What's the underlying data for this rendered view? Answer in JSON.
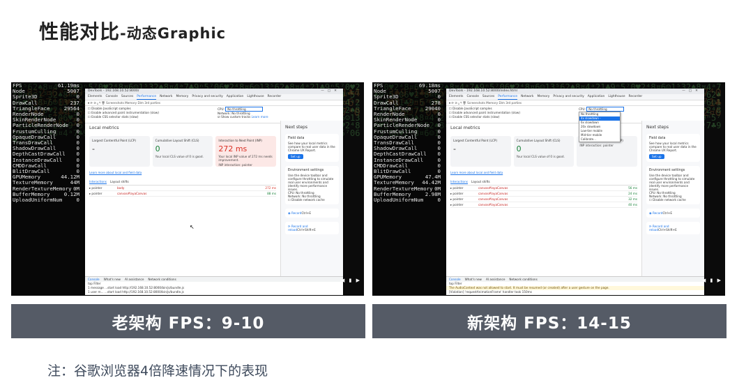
{
  "slide": {
    "title_main": "性能对比",
    "title_sub": "-动态Graphic",
    "note": "注：谷歌浏览器4倍降速情况下的表现"
  },
  "left": {
    "caption": "老架构  FPS：9-10",
    "stats": [
      {
        "k": "FPS",
        "v": "61.19ms"
      },
      {
        "k": "Node",
        "v": "5007"
      },
      {
        "k": "Sprite3D",
        "v": "0"
      },
      {
        "k": "DrawCall",
        "v": "237"
      },
      {
        "k": "TriangleFace",
        "v": "29564"
      },
      {
        "k": "RenderNode",
        "v": "0"
      },
      {
        "k": "SkinRenderNode",
        "v": "0"
      },
      {
        "k": "ParticleRenderNode",
        "v": "0"
      },
      {
        "k": "FrustumCulling",
        "v": "0"
      },
      {
        "k": "OpaqueDrawCall",
        "v": "0"
      },
      {
        "k": "TransDrawCall",
        "v": "0"
      },
      {
        "k": "ShadowDrawCall",
        "v": "0"
      },
      {
        "k": "DepthCastDrawCall",
        "v": "0"
      },
      {
        "k": "InstanceDrawCall",
        "v": "0"
      },
      {
        "k": "CMDDrawCall",
        "v": "0"
      },
      {
        "k": "BlitDrawCall",
        "v": "0"
      },
      {
        "k": "GPUMemory",
        "v": "44.12M"
      },
      {
        "k": "TextureMemory",
        "v": "44M"
      },
      {
        "k": "RenderTextureMemory",
        "v": "0M"
      },
      {
        "k": "BufferMemory",
        "v": "0.12M"
      },
      {
        "k": "UploadUniformNum",
        "v": "0"
      }
    ],
    "devtools": {
      "window_title": "DevTools - 192.168.10.52:8000/",
      "interactions": [
        {
          "a": "pointer",
          "b": "body",
          "c": "272 ms",
          "cls": "warn"
        },
        {
          "a": "pointer",
          "b": "canvas#layaCanvas",
          "c": "88 ms",
          "cls": "ok"
        }
      ],
      "inp_value": "272 ms",
      "cls_value": "0"
    }
  },
  "right": {
    "caption": "新架构 FPS：14-15",
    "stats": [
      {
        "k": "FPS",
        "v": "69.18ms"
      },
      {
        "k": "Node",
        "v": "5007"
      },
      {
        "k": "Sprite3D",
        "v": "0"
      },
      {
        "k": "DrawCall",
        "v": "278"
      },
      {
        "k": "TriangleFace",
        "v": "29040"
      },
      {
        "k": "RenderNode",
        "v": "0"
      },
      {
        "k": "SkinRenderNode",
        "v": "0"
      },
      {
        "k": "ParticleRenderNode",
        "v": "0"
      },
      {
        "k": "FrustumCulling",
        "v": "0"
      },
      {
        "k": "OpaqueDrawCall",
        "v": "0"
      },
      {
        "k": "TransDrawCall",
        "v": "0"
      },
      {
        "k": "ShadowDrawCall",
        "v": "0"
      },
      {
        "k": "DepthCastDrawCall",
        "v": "0"
      },
      {
        "k": "InstanceDrawCall",
        "v": "0"
      },
      {
        "k": "CMDDrawCall",
        "v": "0"
      },
      {
        "k": "BlitDrawCall",
        "v": "0"
      },
      {
        "k": "GPUMemory",
        "v": "47.4M"
      },
      {
        "k": "TextureMemory",
        "v": "44.42M"
      },
      {
        "k": "RenderTextureMemory",
        "v": "0M"
      },
      {
        "k": "BufferMemory",
        "v": "2.98M"
      },
      {
        "k": "UploadUniformNum",
        "v": "0"
      }
    ],
    "devtools": {
      "window_title": "DevTools - 192.168.10.52:8000/index.html",
      "interactions": [
        {
          "a": "pointer",
          "b": "canvas#layaCanvas",
          "c": "56 ms",
          "cls": "ok"
        },
        {
          "a": "pointer",
          "b": "canvas#layaCanvas",
          "c": "24 ms",
          "cls": "ok"
        },
        {
          "a": "pointer",
          "b": "canvas#layaCanvas",
          "c": "32 ms",
          "cls": "ok"
        },
        {
          "a": "pointer",
          "b": "canvas#layaCanvas",
          "c": "40 ms",
          "cls": "ok"
        }
      ],
      "cls_value": "0",
      "dropdown": [
        "No throttling",
        "4x slowdown - recommended",
        "6x slowdown",
        "20x slowdown",
        "Low-tier mobile",
        "Mid-tier mobile",
        "Calibrate..."
      ]
    }
  },
  "devtools_common": {
    "tabs": [
      "Elements",
      "Console",
      "Sources",
      "Performance",
      "Network",
      "Memory",
      "Privacy and security",
      "Application",
      "Lighthouse",
      "Recorder"
    ],
    "toolbar": "Screenshots  Memory  Dim 3rd parties",
    "opt1": "Disable JavaScript samples",
    "opt2": "Enable advanced paint instrumentation (slow)",
    "opt3": "Enable CSS selector stats (slow)",
    "cpu_label": "CPU:",
    "cpu_value": "No throttling",
    "network_label": "Network:",
    "network_value": "No throttling",
    "custom_tracks": "Show custom tracks",
    "learn_more": "Learn more",
    "local_metrics": "Local metrics",
    "lcp_label": "Largest Contentful Paint (LCP)",
    "lcp_value": "-",
    "cls_label": "Cumulative Layout Shift (CLS)",
    "cls_text": "Your local CLS value of 0 is good.",
    "inp_label": "Interaction to Next Paint (INP)",
    "inp_text": "Your local INP value of 272 ms needs improvement.",
    "inp_interaction": "INP interaction: pointer",
    "learn_local": "Learn more about local and field data",
    "itab1": "Interactions",
    "itab2": "Layout shifts",
    "next_steps": "Next steps",
    "field_title": "Field data",
    "field_text": "See how your local metrics compare to real user data in the Chrome UX Report.",
    "setup": "Set up",
    "env_title": "Environment settings",
    "env_text": "Use the device toolbar and configure throttling to simulate real user environments and identify more performance issues.",
    "env_cpu": "CPU: No throttling",
    "env_net": "Network: No throttling",
    "disable_cache": "Disable network cache",
    "record": "Record",
    "record_key": "Ctrl+E",
    "record_reload": "Record and reload",
    "record_reload_key": "Ctrl+Shift+E",
    "console_tabs": [
      "Console",
      "What's new",
      "AI assistance",
      "Network conditions"
    ],
    "console_filter": "top  Filter",
    "console_l1": "1 message  ...start load http://192.168.10.52:8000/bin/js/bundle.js",
    "console_l2": "1 user m...  ...start load http://192.168.10.52:8000/bin/js/bundle.js",
    "console_warn": "The AudioContext was not allowed to start. It must be resumed (or created) after a user gesture on the page.",
    "console_warn2": "[Violation] 'requestAnimationFrame' handler took 150ms",
    "corner": "◀ ▮ ▶"
  },
  "colors": {
    "caption_bg": "#555b66",
    "note": "#3e4a5c",
    "accent": "#1a73e8",
    "good": "#188038",
    "bad": "#d93025"
  }
}
